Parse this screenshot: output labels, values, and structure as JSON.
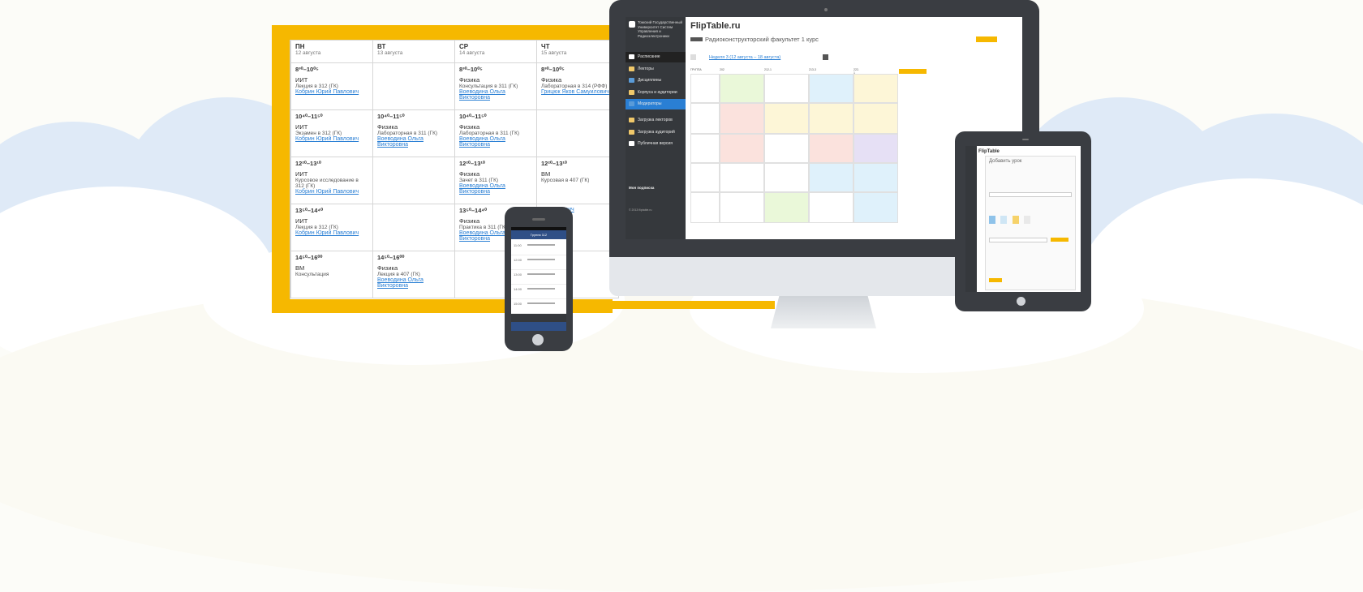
{
  "print_schedule": {
    "days": [
      {
        "name": "ПН",
        "date": "12 августа"
      },
      {
        "name": "ВТ",
        "date": "13 августа"
      },
      {
        "name": "СР",
        "date": "14 августа"
      },
      {
        "name": "ЧТ",
        "date": "15 августа"
      }
    ],
    "rows": [
      [
        {
          "time": "8³⁰–10⁰⁵",
          "subject": "ИИТ",
          "type": "Лекция в 312 (ГК)",
          "teacher": "Кобрин Юрий Павлович"
        },
        {},
        {
          "time": "8³⁰–10⁰⁵",
          "subject": "Физика",
          "type": "Консультация в 311 (ГК)",
          "teacher": "Воеводина Ольга Викторовна"
        },
        {
          "time": "8³⁰–10⁰⁵",
          "subject": "Физика",
          "type": "Лабораторная в 314 (РФФ)",
          "teacher": "Грицюк Яков Самуилович"
        }
      ],
      [
        {
          "time": "10⁴⁰–11⁵⁰",
          "subject": "ИИТ",
          "type": "Экзамен в 312 (ГК)",
          "teacher": "Кобрин Юрий Павлович"
        },
        {
          "time": "10⁴⁰–11⁵⁰",
          "subject": "Физика",
          "type": "Лабораторная в 311 (ГК)",
          "teacher": "Воеводина Ольга Викторовна"
        },
        {
          "time": "10⁴⁰–11⁵⁰",
          "subject": "Физика",
          "type": "Лабораторная в 311 (ГК)",
          "teacher": "Воеводина Ольга Викторовна"
        },
        {}
      ],
      [
        {
          "time": "12²⁰–13¹⁰",
          "subject": "ИИТ",
          "type": "Курсовое исследование в 312 (ГК)",
          "teacher": "Кобрин Юрий Павлович"
        },
        {},
        {
          "time": "12²⁰–13¹⁰",
          "subject": "Физика",
          "type": "Зачет в 311 (ГК)",
          "teacher": "Воеводина Ольга Викторовна"
        },
        {
          "time": "12²⁰–13¹⁰",
          "subject": "ВМ",
          "type": "Курсовая в 407 (ГК)",
          "teacher": ""
        }
      ],
      [
        {
          "time": "13⁵⁰–14⁴⁰",
          "subject": "ИИТ",
          "type": "Лекция в 312 (ГК)",
          "teacher": "Кобрин Юрий Павлович"
        },
        {},
        {
          "time": "13⁵⁰–14⁴⁰",
          "subject": "Физика",
          "type": "Практика в 311 (ГК)",
          "teacher": "Воеводина Ольга Викторовна"
        },
        {
          "time": "",
          "subject": "",
          "type": "",
          "teacher": "Самуилович"
        }
      ],
      [
        {
          "time": "14⁵⁰–16⁰⁰",
          "subject": "ВМ",
          "type": "Консультация",
          "teacher": ""
        },
        {
          "time": "14⁵⁰–16⁰⁰",
          "subject": "Физика",
          "type": "Лекция в 407 (ГК)",
          "teacher": "Воеводина Ольга Викторовна"
        },
        {},
        {}
      ]
    ]
  },
  "desktop_app": {
    "logo_text": "FlipTable.ru",
    "university": "Томский Государственный Университет Систем Управления и Радиоэлектроники",
    "sidebar_items": [
      "Расписание",
      "Лекторы",
      "Дисциплины",
      "Корпуса и аудитории",
      "Модераторы",
      "Загрузка лекторов",
      "Загрузка аудиторий",
      "Публичная версия"
    ],
    "sidebar_footer": "Моя подписка",
    "copyright": "© 2013 fliptable.ru",
    "page_title": "Радиоконструкторский факультет 1 курс",
    "week_label": "Неделя 3 (12 августа – 18 августа)",
    "group_header": "ГРУППА",
    "groups": [
      "202",
      "212-1",
      "213-3",
      "222-1"
    ],
    "colors": {
      "accent": "#f6b800",
      "sidebar": "#35383c",
      "link": "#2a7fd4"
    }
  },
  "phone_app": {
    "header": "Группа 112",
    "times": [
      "11:00",
      "12:00",
      "13:00",
      "14:00",
      "15:00"
    ]
  },
  "tablet_app": {
    "logo_text": "FlipTable",
    "dialog_title": "Добавить урок"
  }
}
